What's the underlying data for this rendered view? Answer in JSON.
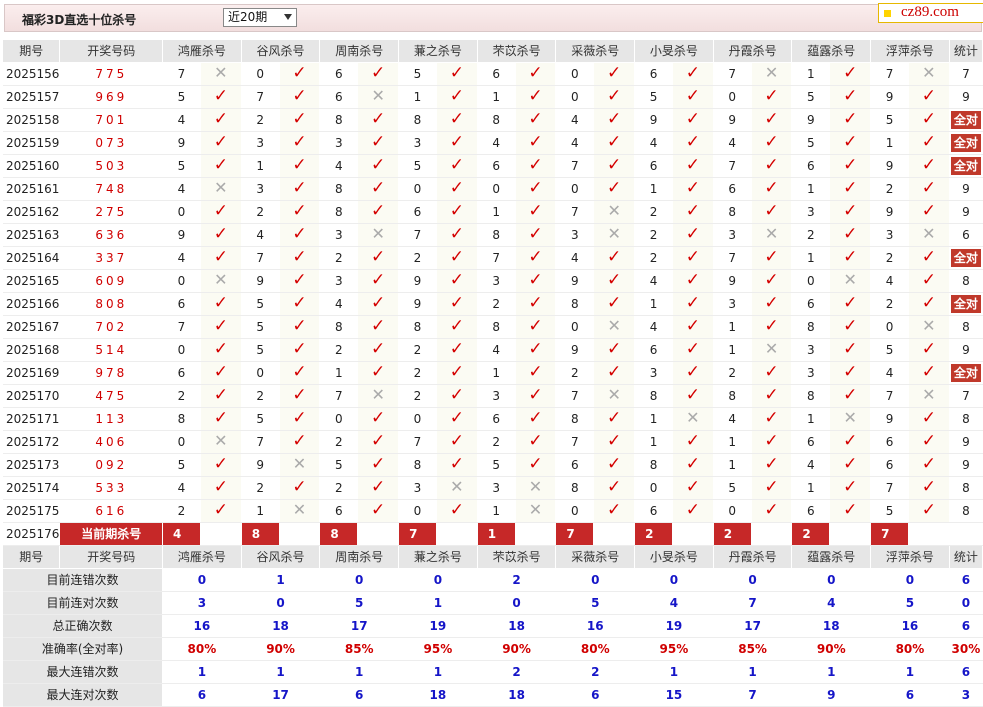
{
  "header": {
    "title": "福彩3D直选十位杀号",
    "period_select": "近20期",
    "logo": "cz89.com"
  },
  "columns": {
    "period": "期号",
    "draw": "开奖号码",
    "experts": [
      "鸿雁杀号",
      "谷风杀号",
      "周南杀号",
      "蒹之杀号",
      "芣苡杀号",
      "采薇杀号",
      "小旻杀号",
      "丹霞杀号",
      "蕴露杀号",
      "浮萍杀号"
    ],
    "stats": "统计"
  },
  "rows": [
    {
      "period": "2025156",
      "draw": "775",
      "picks": [
        [
          "7",
          "x"
        ],
        [
          "0",
          "c"
        ],
        [
          "6",
          "c"
        ],
        [
          "5",
          "c"
        ],
        [
          "6",
          "c"
        ],
        [
          "0",
          "c"
        ],
        [
          "6",
          "c"
        ],
        [
          "7",
          "x"
        ],
        [
          "1",
          "c"
        ],
        [
          "7",
          "x"
        ]
      ],
      "stat": "7"
    },
    {
      "period": "2025157",
      "draw": "969",
      "picks": [
        [
          "5",
          "c"
        ],
        [
          "7",
          "c"
        ],
        [
          "6",
          "x"
        ],
        [
          "1",
          "c"
        ],
        [
          "1",
          "c"
        ],
        [
          "0",
          "c"
        ],
        [
          "5",
          "c"
        ],
        [
          "0",
          "c"
        ],
        [
          "5",
          "c"
        ],
        [
          "9",
          "c"
        ]
      ],
      "stat": "9"
    },
    {
      "period": "2025158",
      "draw": "701",
      "picks": [
        [
          "4",
          "c"
        ],
        [
          "2",
          "c"
        ],
        [
          "8",
          "c"
        ],
        [
          "8",
          "c"
        ],
        [
          "8",
          "c"
        ],
        [
          "4",
          "c"
        ],
        [
          "9",
          "c"
        ],
        [
          "9",
          "c"
        ],
        [
          "9",
          "c"
        ],
        [
          "5",
          "c"
        ]
      ],
      "stat": "全对"
    },
    {
      "period": "2025159",
      "draw": "073",
      "picks": [
        [
          "9",
          "c"
        ],
        [
          "3",
          "c"
        ],
        [
          "3",
          "c"
        ],
        [
          "3",
          "c"
        ],
        [
          "4",
          "c"
        ],
        [
          "4",
          "c"
        ],
        [
          "4",
          "c"
        ],
        [
          "4",
          "c"
        ],
        [
          "5",
          "c"
        ],
        [
          "1",
          "c"
        ]
      ],
      "stat": "全对"
    },
    {
      "period": "2025160",
      "draw": "503",
      "picks": [
        [
          "5",
          "c"
        ],
        [
          "1",
          "c"
        ],
        [
          "4",
          "c"
        ],
        [
          "5",
          "c"
        ],
        [
          "6",
          "c"
        ],
        [
          "7",
          "c"
        ],
        [
          "6",
          "c"
        ],
        [
          "7",
          "c"
        ],
        [
          "6",
          "c"
        ],
        [
          "9",
          "c"
        ]
      ],
      "stat": "全对"
    },
    {
      "period": "2025161",
      "draw": "748",
      "picks": [
        [
          "4",
          "x"
        ],
        [
          "3",
          "c"
        ],
        [
          "8",
          "c"
        ],
        [
          "0",
          "c"
        ],
        [
          "0",
          "c"
        ],
        [
          "0",
          "c"
        ],
        [
          "1",
          "c"
        ],
        [
          "6",
          "c"
        ],
        [
          "1",
          "c"
        ],
        [
          "2",
          "c"
        ]
      ],
      "stat": "9"
    },
    {
      "period": "2025162",
      "draw": "275",
      "picks": [
        [
          "0",
          "c"
        ],
        [
          "2",
          "c"
        ],
        [
          "8",
          "c"
        ],
        [
          "6",
          "c"
        ],
        [
          "1",
          "c"
        ],
        [
          "7",
          "x"
        ],
        [
          "2",
          "c"
        ],
        [
          "8",
          "c"
        ],
        [
          "3",
          "c"
        ],
        [
          "9",
          "c"
        ]
      ],
      "stat": "9"
    },
    {
      "period": "2025163",
      "draw": "636",
      "picks": [
        [
          "9",
          "c"
        ],
        [
          "4",
          "c"
        ],
        [
          "3",
          "x"
        ],
        [
          "7",
          "c"
        ],
        [
          "8",
          "c"
        ],
        [
          "3",
          "x"
        ],
        [
          "2",
          "c"
        ],
        [
          "3",
          "x"
        ],
        [
          "2",
          "c"
        ],
        [
          "3",
          "x"
        ]
      ],
      "stat": "6"
    },
    {
      "period": "2025164",
      "draw": "337",
      "picks": [
        [
          "4",
          "c"
        ],
        [
          "7",
          "c"
        ],
        [
          "2",
          "c"
        ],
        [
          "2",
          "c"
        ],
        [
          "7",
          "c"
        ],
        [
          "4",
          "c"
        ],
        [
          "2",
          "c"
        ],
        [
          "7",
          "c"
        ],
        [
          "1",
          "c"
        ],
        [
          "2",
          "c"
        ]
      ],
      "stat": "全对"
    },
    {
      "period": "2025165",
      "draw": "609",
      "picks": [
        [
          "0",
          "x"
        ],
        [
          "9",
          "c"
        ],
        [
          "3",
          "c"
        ],
        [
          "9",
          "c"
        ],
        [
          "3",
          "c"
        ],
        [
          "9",
          "c"
        ],
        [
          "4",
          "c"
        ],
        [
          "9",
          "c"
        ],
        [
          "0",
          "x"
        ],
        [
          "4",
          "c"
        ]
      ],
      "stat": "8"
    },
    {
      "period": "2025166",
      "draw": "808",
      "picks": [
        [
          "6",
          "c"
        ],
        [
          "5",
          "c"
        ],
        [
          "4",
          "c"
        ],
        [
          "9",
          "c"
        ],
        [
          "2",
          "c"
        ],
        [
          "8",
          "c"
        ],
        [
          "1",
          "c"
        ],
        [
          "3",
          "c"
        ],
        [
          "6",
          "c"
        ],
        [
          "2",
          "c"
        ]
      ],
      "stat": "全对"
    },
    {
      "period": "2025167",
      "draw": "702",
      "picks": [
        [
          "7",
          "c"
        ],
        [
          "5",
          "c"
        ],
        [
          "8",
          "c"
        ],
        [
          "8",
          "c"
        ],
        [
          "8",
          "c"
        ],
        [
          "0",
          "x"
        ],
        [
          "4",
          "c"
        ],
        [
          "1",
          "c"
        ],
        [
          "8",
          "c"
        ],
        [
          "0",
          "x"
        ]
      ],
      "stat": "8"
    },
    {
      "period": "2025168",
      "draw": "514",
      "picks": [
        [
          "0",
          "c"
        ],
        [
          "5",
          "c"
        ],
        [
          "2",
          "c"
        ],
        [
          "2",
          "c"
        ],
        [
          "4",
          "c"
        ],
        [
          "9",
          "c"
        ],
        [
          "6",
          "c"
        ],
        [
          "1",
          "x"
        ],
        [
          "3",
          "c"
        ],
        [
          "5",
          "c"
        ]
      ],
      "stat": "9"
    },
    {
      "period": "2025169",
      "draw": "978",
      "picks": [
        [
          "6",
          "c"
        ],
        [
          "0",
          "c"
        ],
        [
          "1",
          "c"
        ],
        [
          "2",
          "c"
        ],
        [
          "1",
          "c"
        ],
        [
          "2",
          "c"
        ],
        [
          "3",
          "c"
        ],
        [
          "2",
          "c"
        ],
        [
          "3",
          "c"
        ],
        [
          "4",
          "c"
        ]
      ],
      "stat": "全对"
    },
    {
      "period": "2025170",
      "draw": "475",
      "picks": [
        [
          "2",
          "c"
        ],
        [
          "2",
          "c"
        ],
        [
          "7",
          "x"
        ],
        [
          "2",
          "c"
        ],
        [
          "3",
          "c"
        ],
        [
          "7",
          "x"
        ],
        [
          "8",
          "c"
        ],
        [
          "8",
          "c"
        ],
        [
          "8",
          "c"
        ],
        [
          "7",
          "x"
        ]
      ],
      "stat": "7"
    },
    {
      "period": "2025171",
      "draw": "113",
      "picks": [
        [
          "8",
          "c"
        ],
        [
          "5",
          "c"
        ],
        [
          "0",
          "c"
        ],
        [
          "0",
          "c"
        ],
        [
          "6",
          "c"
        ],
        [
          "8",
          "c"
        ],
        [
          "1",
          "x"
        ],
        [
          "4",
          "c"
        ],
        [
          "1",
          "x"
        ],
        [
          "9",
          "c"
        ]
      ],
      "stat": "8"
    },
    {
      "period": "2025172",
      "draw": "406",
      "picks": [
        [
          "0",
          "x"
        ],
        [
          "7",
          "c"
        ],
        [
          "2",
          "c"
        ],
        [
          "7",
          "c"
        ],
        [
          "2",
          "c"
        ],
        [
          "7",
          "c"
        ],
        [
          "1",
          "c"
        ],
        [
          "1",
          "c"
        ],
        [
          "6",
          "c"
        ],
        [
          "6",
          "c"
        ]
      ],
      "stat": "9"
    },
    {
      "period": "2025173",
      "draw": "092",
      "picks": [
        [
          "5",
          "c"
        ],
        [
          "9",
          "x"
        ],
        [
          "5",
          "c"
        ],
        [
          "8",
          "c"
        ],
        [
          "5",
          "c"
        ],
        [
          "6",
          "c"
        ],
        [
          "8",
          "c"
        ],
        [
          "1",
          "c"
        ],
        [
          "4",
          "c"
        ],
        [
          "6",
          "c"
        ]
      ],
      "stat": "9"
    },
    {
      "period": "2025174",
      "draw": "533",
      "picks": [
        [
          "4",
          "c"
        ],
        [
          "2",
          "c"
        ],
        [
          "2",
          "c"
        ],
        [
          "3",
          "x"
        ],
        [
          "3",
          "x"
        ],
        [
          "8",
          "c"
        ],
        [
          "0",
          "c"
        ],
        [
          "5",
          "c"
        ],
        [
          "1",
          "c"
        ],
        [
          "7",
          "c"
        ]
      ],
      "stat": "8"
    },
    {
      "period": "2025175",
      "draw": "616",
      "picks": [
        [
          "2",
          "c"
        ],
        [
          "1",
          "x"
        ],
        [
          "6",
          "c"
        ],
        [
          "0",
          "c"
        ],
        [
          "1",
          "x"
        ],
        [
          "0",
          "c"
        ],
        [
          "6",
          "c"
        ],
        [
          "0",
          "c"
        ],
        [
          "6",
          "c"
        ],
        [
          "5",
          "c"
        ]
      ],
      "stat": "8"
    }
  ],
  "current": {
    "period": "2025176",
    "label": "当前期杀号",
    "picks": [
      "4",
      "8",
      "8",
      "7",
      "1",
      "7",
      "2",
      "2",
      "2",
      "7"
    ]
  },
  "summary": [
    {
      "label": "目前连错次数",
      "values": [
        "0",
        "1",
        "0",
        "0",
        "2",
        "0",
        "0",
        "0",
        "0",
        "0",
        "6"
      ]
    },
    {
      "label": "目前连对次数",
      "values": [
        "3",
        "0",
        "5",
        "1",
        "0",
        "5",
        "4",
        "7",
        "4",
        "5",
        "0"
      ]
    },
    {
      "label": "总正确次数",
      "values": [
        "16",
        "18",
        "17",
        "19",
        "18",
        "16",
        "19",
        "17",
        "18",
        "16",
        "6"
      ]
    },
    {
      "label": "准确率(全对率)",
      "values": [
        "80%",
        "90%",
        "85%",
        "95%",
        "90%",
        "80%",
        "95%",
        "85%",
        "90%",
        "80%",
        "30%"
      ]
    },
    {
      "label": "最大连错次数",
      "values": [
        "1",
        "1",
        "1",
        "1",
        "2",
        "2",
        "1",
        "1",
        "1",
        "1",
        "6"
      ]
    },
    {
      "label": "最大连对次数",
      "values": [
        "6",
        "17",
        "6",
        "18",
        "18",
        "6",
        "15",
        "7",
        "9",
        "6",
        "3"
      ]
    }
  ],
  "icons": {
    "correct": "check-icon",
    "wrong": "cross-icon"
  },
  "colors": {
    "accent": "#c62828",
    "draw_number": "#d00000",
    "summary_value": "#1515c8",
    "rate": "#d00000"
  }
}
